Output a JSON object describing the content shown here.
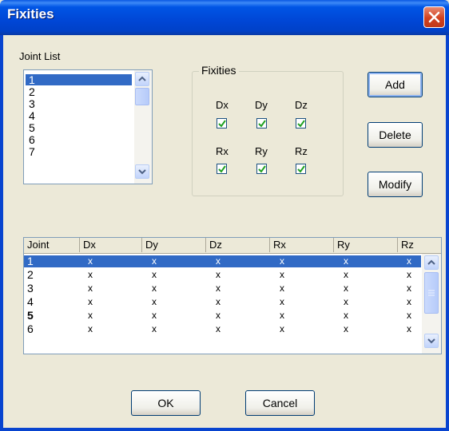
{
  "window": {
    "title": "Fixities"
  },
  "joint_list": {
    "label": "Joint List",
    "items": [
      "1",
      "2",
      "3",
      "4",
      "5",
      "6",
      "7"
    ],
    "selected_index": 0
  },
  "fixities_group": {
    "label": "Fixities",
    "dx": {
      "label": "Dx",
      "checked": true
    },
    "dy": {
      "label": "Dy",
      "checked": true
    },
    "dz": {
      "label": "Dz",
      "checked": true
    },
    "rx": {
      "label": "Rx",
      "checked": true
    },
    "ry": {
      "label": "Ry",
      "checked": true
    },
    "rz": {
      "label": "Rz",
      "checked": true
    }
  },
  "buttons": {
    "add": "Add",
    "delete": "Delete",
    "modify": "Modify",
    "ok": "OK",
    "cancel": "Cancel"
  },
  "table": {
    "headers": [
      "Joint",
      "Dx",
      "Dy",
      "Dz",
      "Rx",
      "Ry",
      "Rz"
    ],
    "rows": [
      [
        "1",
        "x",
        "x",
        "x",
        "x",
        "x",
        "x"
      ],
      [
        "2",
        "x",
        "x",
        "x",
        "x",
        "x",
        "x"
      ],
      [
        "3",
        "x",
        "x",
        "x",
        "x",
        "x",
        "x"
      ],
      [
        "4",
        "x",
        "x",
        "x",
        "x",
        "x",
        "x"
      ],
      [
        "5",
        "x",
        "x",
        "x",
        "x",
        "x",
        "x"
      ],
      [
        "6",
        "x",
        "x",
        "x",
        "x",
        "x",
        "x"
      ]
    ],
    "selected_row": 0
  },
  "colors": {
    "titlebar": "#0054e3",
    "selection": "#316ac5",
    "dialog_bg": "#ece9d8"
  }
}
